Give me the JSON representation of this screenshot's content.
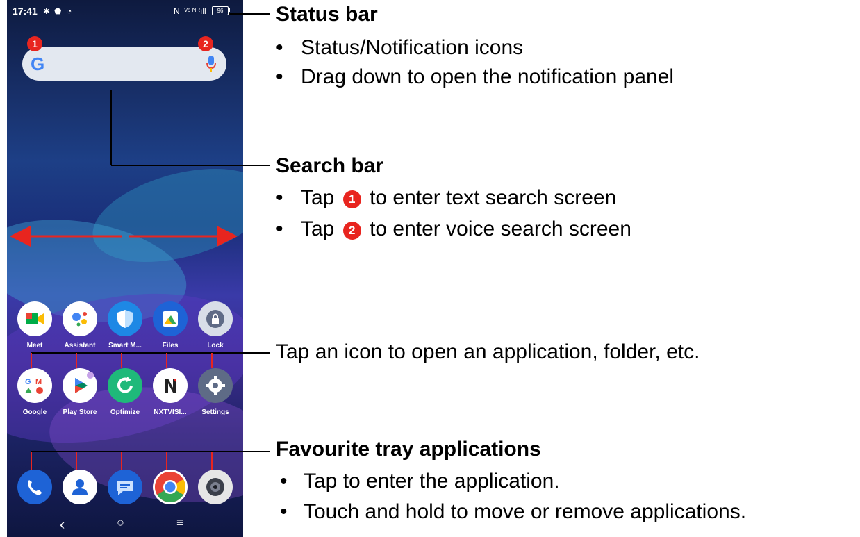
{
  "phone": {
    "status_time": "17:41",
    "battery_level": "96",
    "network_label": "Vo NR",
    "search_badge_1": "1",
    "search_badge_2": "2"
  },
  "apps_row1": [
    {
      "label": "Meet",
      "icon": "meet-icon",
      "color": "#ffffff"
    },
    {
      "label": "Assistant",
      "icon": "assistant-icon",
      "color": "#ffffff"
    },
    {
      "label": "Smart M...",
      "icon": "shield-icon",
      "color": "#1e88e5"
    },
    {
      "label": "Files",
      "icon": "files-icon",
      "color": "#1e63d6"
    },
    {
      "label": "Lock",
      "icon": "lock-icon",
      "color": "#d8dee8"
    }
  ],
  "apps_row2": [
    {
      "label": "Google",
      "icon": "google-folder-icon",
      "color": "#ffffff"
    },
    {
      "label": "Play Store",
      "icon": "play-store-icon",
      "color": "#ffffff"
    },
    {
      "label": "Optimize",
      "icon": "optimize-icon",
      "color": "#1fb97a"
    },
    {
      "label": "NXTVISI...",
      "icon": "nxtvision-icon",
      "color": "#ffffff"
    },
    {
      "label": "Settings",
      "icon": "settings-icon",
      "color": "#5e6b86"
    }
  ],
  "tray": [
    {
      "icon": "phone-icon",
      "color": "#1e63d6"
    },
    {
      "icon": "contacts-icon",
      "color": "#ffffff"
    },
    {
      "icon": "messages-icon",
      "color": "#1e63d6"
    },
    {
      "icon": "chrome-icon",
      "color": "#ffffff"
    },
    {
      "icon": "camera-icon",
      "color": "#e6e6e6"
    }
  ],
  "nav": {
    "back": "‹",
    "home": "○",
    "menu": "≡"
  },
  "annotations": {
    "status_bar": {
      "title": "Status bar",
      "bullets": [
        "Status/Notification icons",
        "Drag down to open the notification panel"
      ]
    },
    "search_bar": {
      "title": "Search bar",
      "bullet1_pre": "Tap",
      "bullet1_num": "1",
      "bullet1_post": "to enter text search screen",
      "bullet2_pre": "Tap",
      "bullet2_num": "2",
      "bullet2_post": "to enter voice search screen"
    },
    "apps": {
      "text": "Tap an icon to open an application, folder, etc."
    },
    "favourites": {
      "title": "Favourite tray applications",
      "bullets": [
        "Tap to enter the application.",
        "Touch and hold to move or remove applications."
      ]
    }
  },
  "colors": {
    "accent_red": "#e8251f"
  }
}
